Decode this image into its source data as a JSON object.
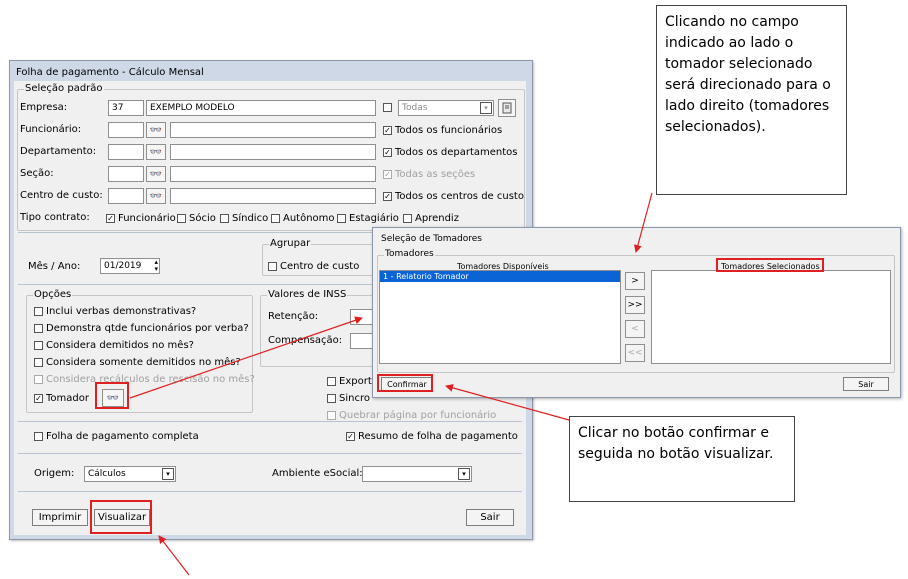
{
  "window": {
    "title": "Folha de pagamento - Cálculo Mensal",
    "selecao": {
      "legend": "Seleção padrão",
      "empresa_label": "Empresa:",
      "empresa_code": "37",
      "empresa_name": "EXEMPLO MODELO",
      "todas_select": "Todas",
      "funcionario_label": "Funcionário:",
      "departamento_label": "Departamento:",
      "secao_label": "Seção:",
      "centro_label": "Centro de custo:",
      "todos_funcionarios": "Todos os funcionários",
      "todos_departamentos": "Todos os departamentos",
      "todas_secoes": "Todas as seções",
      "todos_centros": "Todos os centros de custo",
      "tipo_contrato_label": "Tipo contrato:",
      "contrato_options": [
        "Funcionário",
        "Sócio",
        "Síndico",
        "Autônomo",
        "Estagiário",
        "Aprendiz"
      ]
    },
    "periodo": {
      "mes_ano_label": "Mês / Ano:",
      "mes_ano_value": "01/2019",
      "agrupar_legend": "Agrupar",
      "centro_custo": "Centro de custo"
    },
    "opcoes": {
      "legend": "Opções",
      "items": [
        "Inclui verbas demonstrativas?",
        "Demonstra qtde funcionários por verba?",
        "Considera demitidos no mês?",
        "Considera somente demitidos no mês?",
        "Considera recálculos de rescisão no mês?",
        "Tomador"
      ]
    },
    "inss": {
      "legend": "Valores de INSS",
      "retencao": "Retenção:",
      "compensacao": "Compensação:"
    },
    "extra": {
      "export": "Export",
      "sincro": "Sincro",
      "quebrar": "Quebrar página por funcionário"
    },
    "folha_completa": "Folha de pagamento completa",
    "resumo": "Resumo de folha de pagamento",
    "origem_label": "Origem:",
    "origem_value": "Cálculos",
    "ambiente_label": "Ambiente eSocial:",
    "imprimir": "Imprimir",
    "visualizar": "Visualizar",
    "sair": "Sair"
  },
  "dialog": {
    "title": "Seleção de Tomadores",
    "legend": "Tomadores",
    "disponiveis_header": "Tomadores Disponíveis",
    "selecionados_header": "Tomadores Selecionados",
    "disponiveis_items": [
      "1 - Relatorio Tomador"
    ],
    "move_one": ">",
    "move_all": ">>",
    "remove_one": "<",
    "remove_all": "<<",
    "confirmar": "Confirmar",
    "sair": "Sair"
  },
  "callouts": {
    "top": "Clicando no campo indicado ao lado o tomador selecionado será direcionado para o lado direito (tomadores selecionados).",
    "bottom": "Clicar no botão confirmar e seguida no botão visualizar."
  },
  "colors": {
    "annotation_red": "#e02020",
    "window_frame": "#cfd8e6",
    "selection_blue": "#0a64d6"
  }
}
